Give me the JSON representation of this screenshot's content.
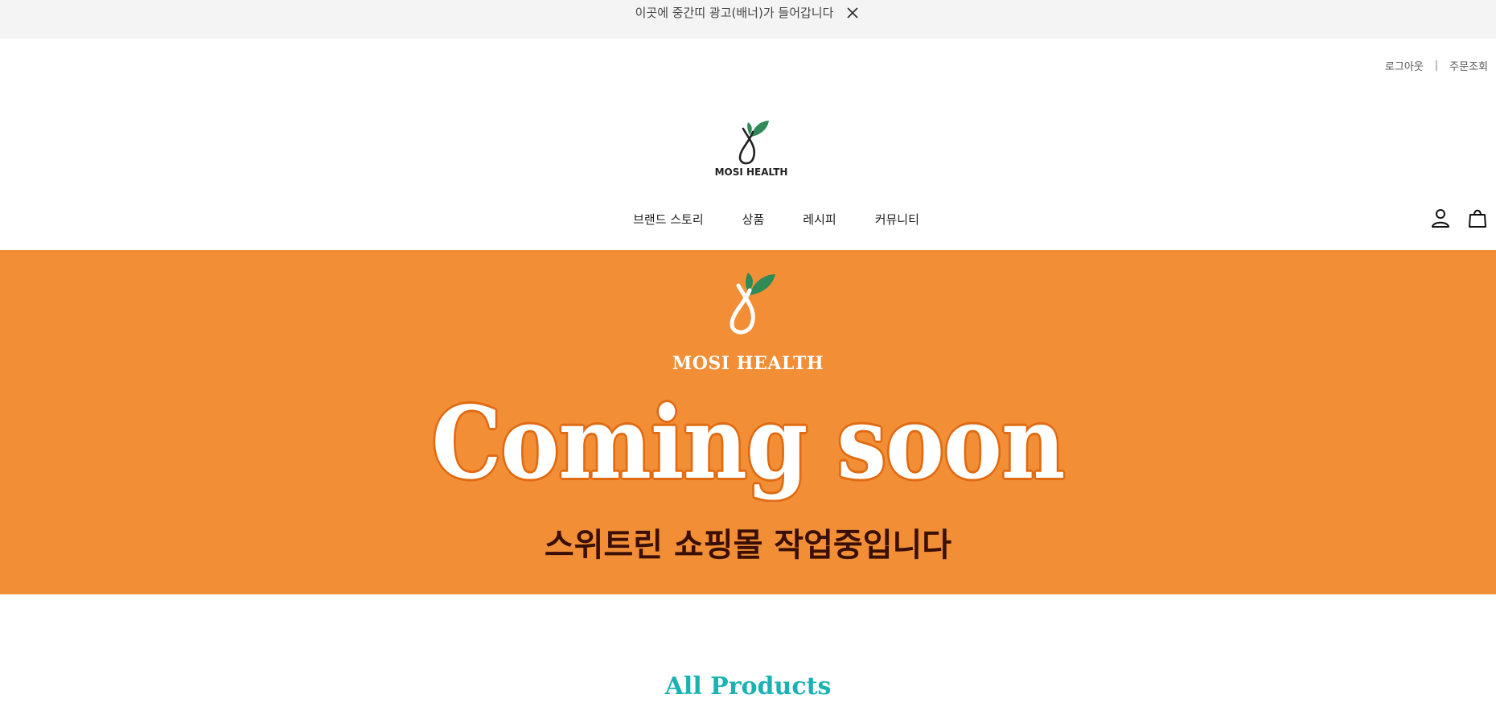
{
  "top_banner": {
    "text": "이곳에 중간띠 광고(배너)가 들어갑니다",
    "close_icon": "close-icon"
  },
  "util_links": {
    "logout": "로그아웃",
    "separator": "|",
    "order_lookup": "주문조회"
  },
  "logo": {
    "brand": "MOSI HEALTH",
    "icon": "mosi-health-logo",
    "leaf_color": "#2e8b57",
    "drop_color": "#222222"
  },
  "nav": {
    "items": [
      {
        "label": "브랜드 스토리"
      },
      {
        "label": "상품"
      },
      {
        "label": "레시피"
      },
      {
        "label": "커뮤니티"
      }
    ]
  },
  "header_icons": {
    "user": "user-icon",
    "cart": "shopping-bag-icon"
  },
  "hero": {
    "background": "#f18e36",
    "brand": "MOSI HEALTH",
    "title": "Coming soon",
    "subtitle": "스위트린 쇼핑몰 작업중입니다"
  },
  "products_section": {
    "title": "All Products",
    "title_color": "#1ab2b2"
  }
}
